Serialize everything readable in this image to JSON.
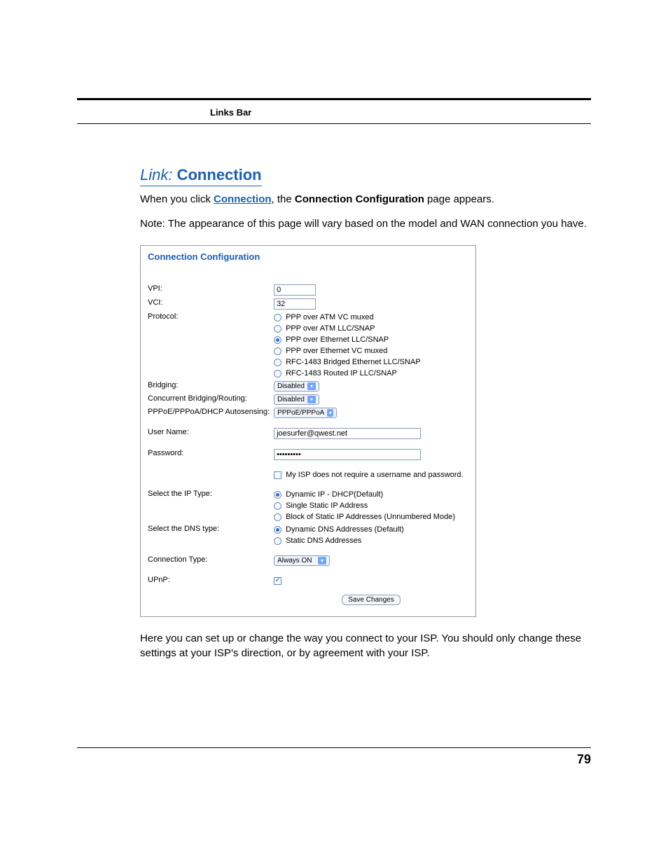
{
  "header": {
    "links_bar": "Links Bar"
  },
  "section": {
    "link_prefix": "Link:",
    "link_name": "Connection",
    "intro_pre": "When you click ",
    "intro_link": "Connection",
    "intro_mid": ", the ",
    "intro_bold": "Connection Configuration",
    "intro_post": " page appears.",
    "note": "Note: The appearance of this page will vary based on the model and WAN connection you have."
  },
  "panel": {
    "title": "Connection Configuration",
    "labels": {
      "vpi": "VPI:",
      "vci": "VCI:",
      "protocol": "Protocol:",
      "bridging": "Bridging:",
      "concurrent": "Concurrent Bridging/Routing:",
      "autosensing": "PPPoE/PPPoA/DHCP Autosensing:",
      "username": "User Name:",
      "password": "Password:",
      "ip_type": "Select the IP Type:",
      "dns_type": "Select the DNS type:",
      "conn_type": "Connection Type:",
      "upnp": "UPnP:"
    },
    "values": {
      "vpi": "0",
      "vci": "32",
      "username": "joesurfer@qwest.net",
      "password_mask": "•••••••••"
    },
    "protocol_options": [
      "PPP over ATM VC muxed",
      "PPP over ATM LLC/SNAP",
      "PPP over Ethernet LLC/SNAP",
      "PPP over Ethernet VC muxed",
      "RFC-1483 Bridged Ethernet LLC/SNAP",
      "RFC-1483 Routed IP LLC/SNAP"
    ],
    "selects": {
      "bridging": "Disabled",
      "concurrent": "Disabled",
      "autosensing": "PPPoE/PPPoA",
      "conn_type": "Always ON"
    },
    "no_creds": "My ISP does not require a username and password.",
    "ip_options": [
      "Dynamic IP - DHCP(Default)",
      "Single Static IP Address",
      "Block of Static IP Addresses (Unnumbered Mode)"
    ],
    "dns_options": [
      "Dynamic DNS Addresses (Default)",
      "Static DNS Addresses"
    ],
    "save_button": "Save Changes"
  },
  "body_after": "Here you can set up or change the way you connect to your ISP. You should only change these settings at your ISP's direction, or by agreement with your ISP.",
  "page_number": "79"
}
